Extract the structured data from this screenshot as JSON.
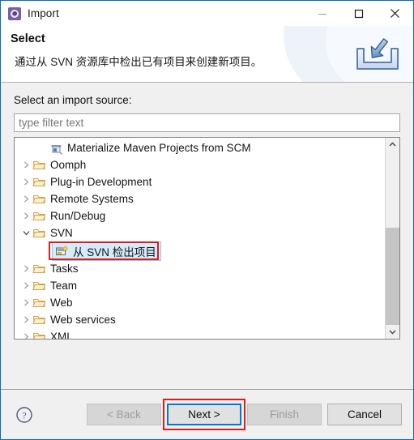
{
  "window": {
    "title": "Import",
    "app_icon": "eclipse-import-icon",
    "controls": {
      "minimize": "minimize-icon",
      "maximize": "maximize-icon",
      "close": "close-icon"
    }
  },
  "header": {
    "title": "Select",
    "description": "通过从 SVN 资源库中检出已有项目来创建新项目。",
    "banner_icon": "import-tray-icon"
  },
  "form": {
    "source_label": "Select an import source:",
    "filter_placeholder": "type filter text",
    "filter_value": ""
  },
  "tree": {
    "items": [
      {
        "label": "Materialize Maven Projects from SCM",
        "icon": "maven-scm-icon",
        "indent": 1,
        "expander": "none",
        "selected": false,
        "annotated": false
      },
      {
        "label": "Oomph",
        "icon": "folder-icon",
        "indent": 0,
        "expander": "collapsed",
        "selected": false,
        "annotated": false
      },
      {
        "label": "Plug-in Development",
        "icon": "folder-icon",
        "indent": 0,
        "expander": "collapsed",
        "selected": false,
        "annotated": false
      },
      {
        "label": "Remote Systems",
        "icon": "folder-icon",
        "indent": 0,
        "expander": "collapsed",
        "selected": false,
        "annotated": false
      },
      {
        "label": "Run/Debug",
        "icon": "folder-icon",
        "indent": 0,
        "expander": "collapsed",
        "selected": false,
        "annotated": false
      },
      {
        "label": "SVN",
        "icon": "folder-icon",
        "indent": 0,
        "expander": "expanded",
        "selected": false,
        "annotated": false
      },
      {
        "label": "从 SVN 检出项目",
        "icon": "svn-checkout-icon",
        "indent": 2,
        "expander": "none",
        "selected": true,
        "annotated": true
      },
      {
        "label": "Tasks",
        "icon": "folder-icon",
        "indent": 0,
        "expander": "collapsed",
        "selected": false,
        "annotated": false
      },
      {
        "label": "Team",
        "icon": "folder-icon",
        "indent": 0,
        "expander": "collapsed",
        "selected": false,
        "annotated": false
      },
      {
        "label": "Web",
        "icon": "folder-icon",
        "indent": 0,
        "expander": "collapsed",
        "selected": false,
        "annotated": false
      },
      {
        "label": "Web services",
        "icon": "folder-icon",
        "indent": 0,
        "expander": "collapsed",
        "selected": false,
        "annotated": false
      },
      {
        "label": "XML",
        "icon": "folder-icon",
        "indent": 0,
        "expander": "collapsed",
        "selected": false,
        "annotated": false
      }
    ],
    "scrollbar": {
      "up_arrow": "chevron-up-icon",
      "down_arrow": "chevron-down-icon",
      "thumb_position_percent": 44
    }
  },
  "footer": {
    "help_icon": "help-circle-icon",
    "buttons": [
      {
        "label": "< Back",
        "state": "disabled",
        "focused": false,
        "annotated": false
      },
      {
        "label": "Next >",
        "state": "enabled",
        "focused": true,
        "annotated": true
      },
      {
        "label": "Finish",
        "state": "disabled",
        "focused": false,
        "annotated": false
      },
      {
        "label": "Cancel",
        "state": "enabled",
        "focused": false,
        "annotated": false
      }
    ]
  },
  "colors": {
    "window_border": "#0a6cbd",
    "focus_blue": "#0078d7",
    "annotation_red": "#e01b1b",
    "selection_blue": "#d4ebfb",
    "body_bg": "#f0f0f0"
  }
}
